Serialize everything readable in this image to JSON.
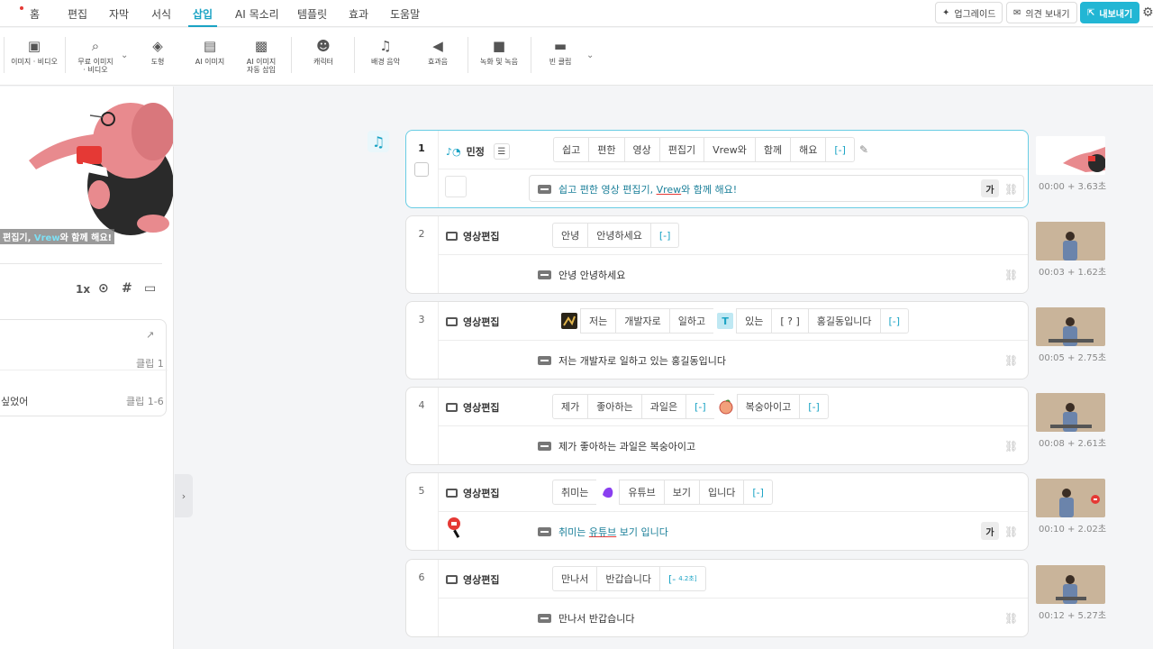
{
  "menu": {
    "items": [
      "홈",
      "편집",
      "자막",
      "서식",
      "삽입",
      "AI 목소리",
      "템플릿",
      "효과",
      "도움말"
    ],
    "active": "삽입"
  },
  "top_buttons": {
    "upgrade": "업그레이드",
    "feedback": "의견 보내기",
    "export": "내보내기"
  },
  "toolbar": {
    "image_video": "이미지 · 비디오",
    "free_image_1": "무료 이미지",
    "free_image_2": "· 비디오",
    "shape": "도형",
    "ai_image": "AI 이미지",
    "ai_auto_1": "AI 이미지",
    "ai_auto_2": "자동 삽입",
    "character": "캐릭터",
    "bgm": "배경 음악",
    "sfx": "효과음",
    "record": "녹화 및 녹음",
    "empty_clip": "빈 클립"
  },
  "preview": {
    "caption_before": "편집기, ",
    "caption_highlight": "Vrew",
    "caption_after": "와 함께 해요!"
  },
  "controls": {
    "speed": "1x"
  },
  "side_list": {
    "item1_clip": "클립 1",
    "item2_text": "싶었어",
    "item2_clip": "클립 1-6"
  },
  "clips": [
    {
      "num": "1",
      "speaker": "민정",
      "words": [
        "쉽고",
        "편한",
        "영상",
        "편집기",
        "Vrew와",
        "함께",
        "해요",
        "[-]"
      ],
      "subtitle_before": "쉽고 편한 영상 편집기, ",
      "subtitle_underlined": "Vrew",
      "subtitle_after": "와 함께 해요!",
      "ga": "가",
      "time": "00:00 + 3.63초"
    },
    {
      "num": "2",
      "speaker": "영상편집",
      "words": [
        "안녕",
        "안녕하세요",
        "[-]"
      ],
      "subtitle": "안녕 안녕하세요",
      "time": "00:03 + 1.62초"
    },
    {
      "num": "3",
      "speaker": "영상편집",
      "words": [
        "저는",
        "개발자로",
        "일하고",
        "있는",
        "[ ? ]",
        "홍길동입니다",
        "[-]"
      ],
      "subtitle": "저는 개발자로 일하고 있는 홍길동입니다",
      "time": "00:05 + 2.75초"
    },
    {
      "num": "4",
      "speaker": "영상편집",
      "words": [
        "제가",
        "좋아하는",
        "과일은",
        "[-]",
        "복숭아이고",
        "[-]"
      ],
      "subtitle": "제가 좋아하는 과일은 복숭아이고",
      "time": "00:08 + 2.61초"
    },
    {
      "num": "5",
      "speaker": "영상편집",
      "words": [
        "취미는",
        "유튜브",
        "보기",
        "입니다",
        "[-]"
      ],
      "subtitle_before": "취미는 ",
      "subtitle_underlined": "유튜브",
      "subtitle_after": " 보기 입니다",
      "ga": "가",
      "time": "00:10 + 2.02초"
    },
    {
      "num": "6",
      "speaker": "영상편집",
      "words": [
        "만나서",
        "반갑습니다",
        "[-"
      ],
      "gap_label": "4.2초]",
      "subtitle": "만나서 반갑습니다",
      "time": "00:12 + 5.27초"
    }
  ]
}
